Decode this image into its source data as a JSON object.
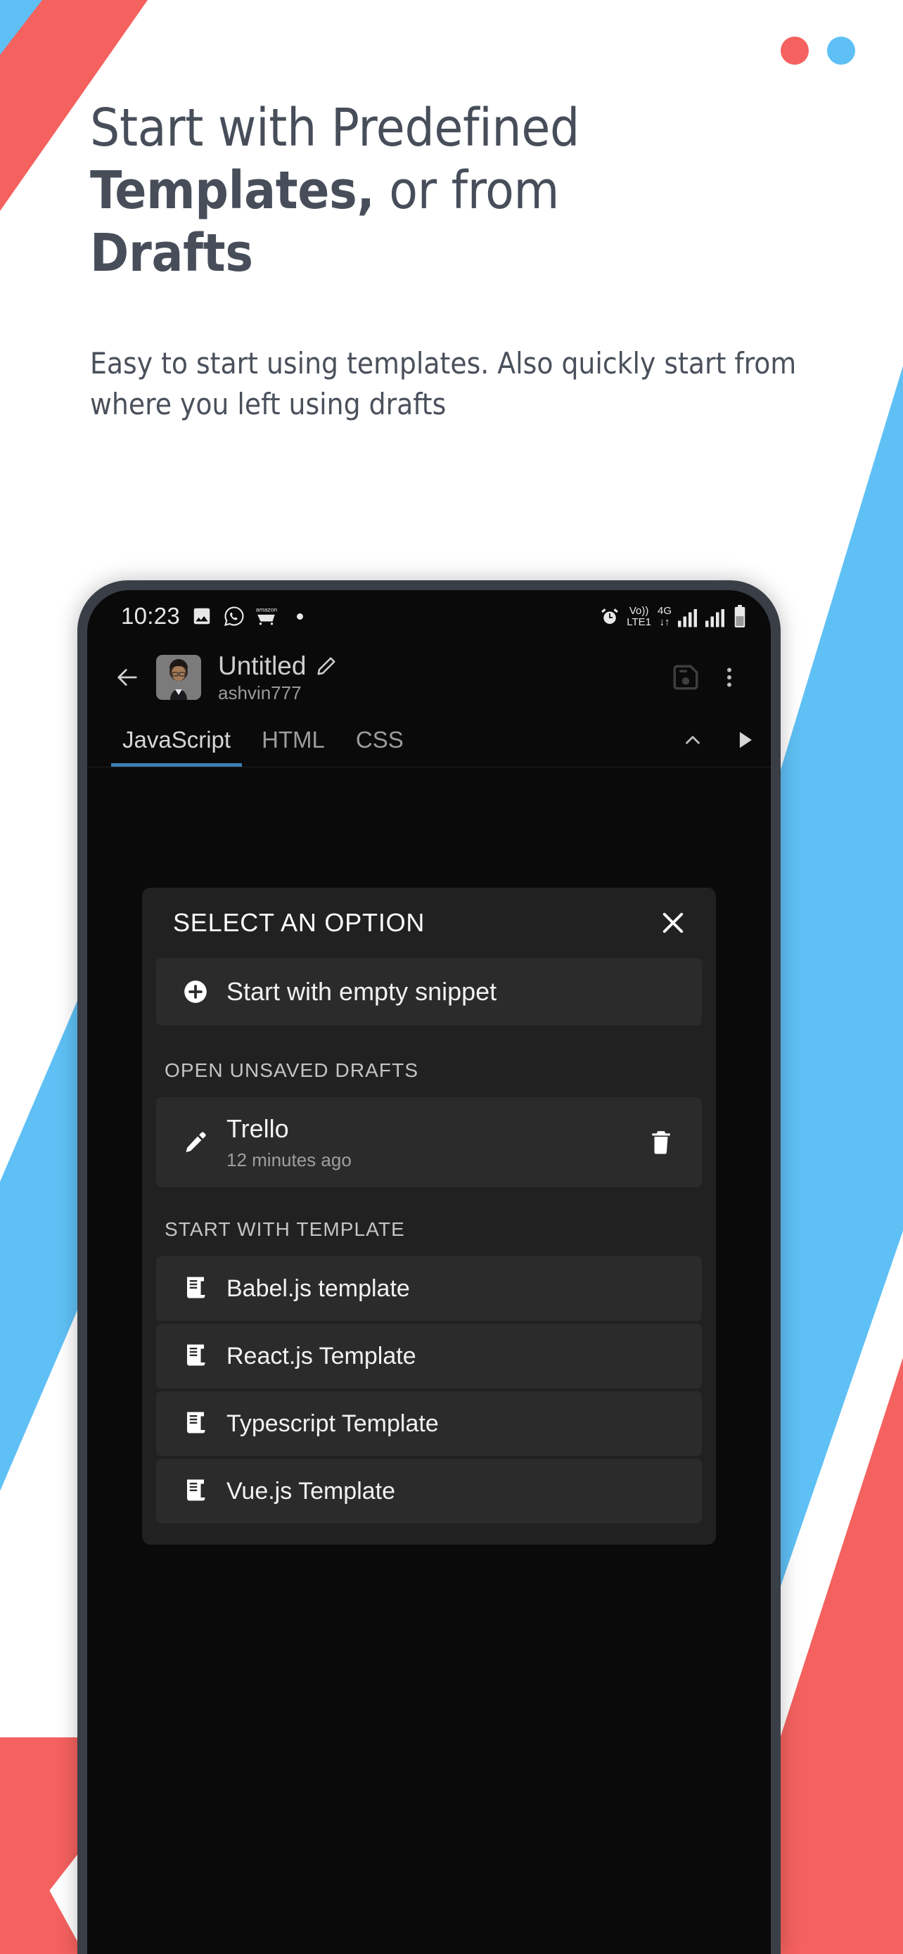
{
  "brand": {
    "accent_red": "#F4615E",
    "accent_blue": "#5FC0F5",
    "dot_red_name": "red-dot",
    "dot_blue_name": "blue-dot"
  },
  "promo": {
    "headline_line1": "Start with Predefined",
    "headline_bold1": "Templates,",
    "headline_rest1": " or from",
    "headline_bold2": "Drafts",
    "subcopy": "Easy to start using templates. Also quickly start from where you left using drafts"
  },
  "phone": {
    "statusbar": {
      "time": "10:23",
      "icons_left": [
        "image-icon",
        "whatsapp-icon",
        "amazon-cart-icon"
      ],
      "alarm": "alarm-icon",
      "volte_top": "Vo))",
      "volte_bottom": "LTE1",
      "network_top": "4G",
      "network_bottom": "↓↑",
      "signal": "signal-bars",
      "battery": "battery-icon"
    },
    "toolbar": {
      "back": "back-arrow-icon",
      "title": "Untitled",
      "edit": "pencil-icon",
      "username": "ashvin777",
      "save": "save-icon",
      "menu": "overflow-menu-icon"
    },
    "tabs": {
      "items": [
        {
          "label": "JavaScript",
          "active": true
        },
        {
          "label": "HTML",
          "active": false
        },
        {
          "label": "CSS",
          "active": false
        }
      ],
      "collapse": "chevron-up-icon",
      "run": "play-icon",
      "active_underline_color": "#3B7FB5"
    },
    "dialog": {
      "title": "SELECT AN OPTION",
      "close": "close-icon",
      "empty_snippet": {
        "label": "Start with empty snippet",
        "icon": "plus-circle-icon"
      },
      "drafts_label": "OPEN UNSAVED DRAFTS",
      "drafts": [
        {
          "name": "Trello",
          "time": "12 minutes ago",
          "icon": "pencil-icon",
          "delete": "trash-icon"
        }
      ],
      "templates_label": "START WITH TEMPLATE",
      "templates": [
        {
          "label": "Babel.js template",
          "icon": "script-icon"
        },
        {
          "label": "React.js Template",
          "icon": "script-icon"
        },
        {
          "label": "Typescript Template",
          "icon": "script-icon"
        },
        {
          "label": "Vue.js Template",
          "icon": "script-icon"
        }
      ]
    }
  }
}
